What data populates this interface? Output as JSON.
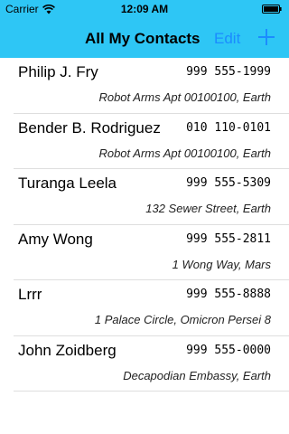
{
  "status_bar": {
    "carrier": "Carrier",
    "time": "12:09 AM"
  },
  "nav_bar": {
    "title": "All My Contacts",
    "edit_label": "Edit",
    "add_icon": "plus-icon",
    "accent_color": "#1b8cff",
    "background_color": "#2ec6f5"
  },
  "contacts": [
    {
      "name": "Philip J. Fry",
      "phone": "999 555-1999",
      "address": "Robot Arms Apt 00100100, Earth"
    },
    {
      "name": "Bender B. Rodriguez",
      "phone": "010 110-0101",
      "address": "Robot Arms Apt 00100100, Earth"
    },
    {
      "name": "Turanga Leela",
      "phone": "999 555-5309",
      "address": "132 Sewer Street, Earth"
    },
    {
      "name": "Amy Wong",
      "phone": "999 555-2811",
      "address": "1 Wong Way, Mars"
    },
    {
      "name": "Lrrr",
      "phone": "999 555-8888",
      "address": "1 Palace Circle, Omicron Persei 8"
    },
    {
      "name": "John Zoidberg",
      "phone": "999 555-0000",
      "address": "Decapodian Embassy, Earth"
    }
  ]
}
